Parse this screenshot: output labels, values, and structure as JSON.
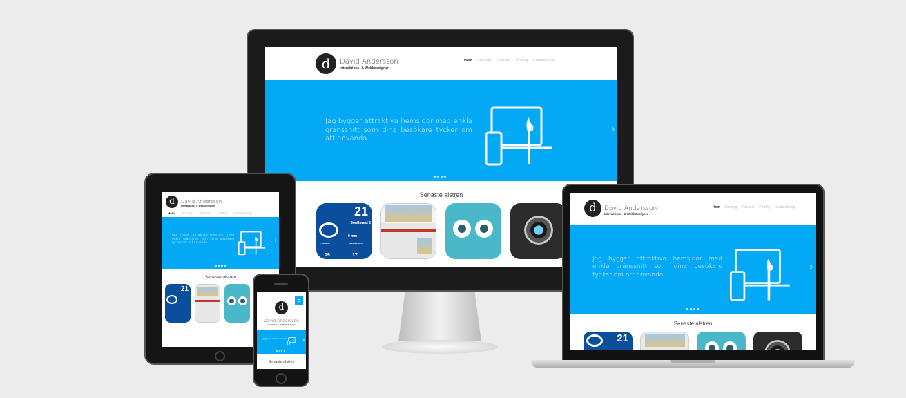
{
  "site": {
    "logo_letter": "d",
    "brand_name": "David Andersson",
    "brand_subtitle": "Interaktions- & Webbdesigner",
    "nav": [
      "Hem",
      "Om mig",
      "Tjänster",
      "Portfölj",
      "Kontakta mig"
    ],
    "hero_text": "Jag bygger attraktiva hemsidor med enkla gränssnitt som dina besökare tycker om att använda.",
    "section_title": "Senaste alstren",
    "weather_temp": "21",
    "weather_wind": "Southwest 2",
    "weather_rain": "0 mm",
    "weather_day1": "TUESDAY",
    "weather_day2": "WEDNESDAY",
    "weather_low1": "19",
    "weather_low2": "17"
  },
  "icons": [
    "logo-icon",
    "monitor-phone-brush-icon",
    "chevron-right-icon",
    "hamburger-menu-icon",
    "cloud-icon",
    "owl-eyes-icon",
    "camera-lens-icon"
  ],
  "colors": {
    "accent": "#03a9f4",
    "bezel": "#1c1c1c",
    "weather": "#0b4f9c",
    "owl": "#4ab8c9"
  }
}
